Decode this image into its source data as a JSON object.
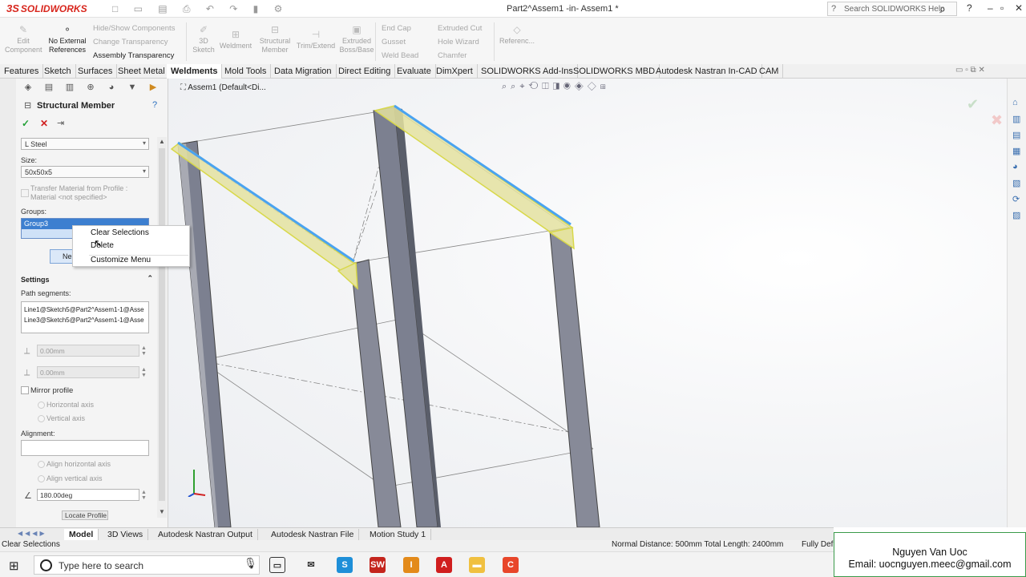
{
  "app": {
    "logo": "SOLIDWORKS",
    "logo_mark": "3S",
    "document_title": "Part2^Assem1 -in- Assem1 *",
    "search_placeholder": "Search SOLIDWORKS Help"
  },
  "command_manager": {
    "edit_component": "Edit Component",
    "no_external_references": "No External References",
    "hide_show": "Hide/Show Components",
    "change_transparency": "Change Transparency",
    "assembly_transparency": "Assembly Transparency",
    "sketch3d": "3D Sketch",
    "weldment": "Weldment",
    "structural_member": "Structural Member",
    "trim_extend": "Trim/Extend",
    "extruded_boss": "Extruded Boss/Base",
    "end_cap": "End Cap",
    "gusset": "Gusset",
    "weld_bead": "Weld Bead",
    "extruded_cut": "Extruded Cut",
    "hole_wizard": "Hole Wizard",
    "chamfer": "Chamfer",
    "reference": "Referenc..."
  },
  "tabs": [
    "Features",
    "Sketch",
    "Surfaces",
    "Sheet Metal",
    "Weldments",
    "Mold Tools",
    "Data Migration",
    "Direct Editing",
    "Evaluate",
    "DimXpert",
    "SOLIDWORKS Add-Ins",
    "SOLIDWORKS MBD",
    "Autodesk Nastran In-CAD",
    "CAM"
  ],
  "active_tab": "Weldments",
  "property_manager": {
    "title": "Structural Member",
    "profile_type": "L Steel",
    "size_label": "Size:",
    "size_value": "50x50x5",
    "transfer_material": "Transfer Material from Profile :",
    "material": "Material <not specified>",
    "groups_label": "Groups:",
    "group_selected": "Group3",
    "new_group": "Ne",
    "settings_label": "Settings",
    "path_segments_label": "Path segments:",
    "path_segments": [
      "Line1@Sketch5@Part2^Assem1-1@Asse",
      "Line3@Sketch5@Part2^Assem1-1@Asse"
    ],
    "offset1": "0.00mm",
    "offset2": "0.00mm",
    "mirror_profile": "Mirror profile",
    "horizontal_axis": "Horizontal axis",
    "vertical_axis": "Vertical axis",
    "alignment_label": "Alignment:",
    "align_horizontal": "Align horizontal axis",
    "align_vertical": "Align vertical axis",
    "rotation_angle": "180.00deg",
    "locate_profile": "Locate Profile"
  },
  "context_menu": {
    "items": [
      "Clear Selections",
      "Delete",
      "Customize Menu"
    ]
  },
  "viewport": {
    "tree_item": "Assem1  (Default<Di..."
  },
  "model_tabs": [
    "Model",
    "3D Views",
    "Autodesk Nastran Output",
    "Autodesk Nastran File",
    "Motion Study 1"
  ],
  "active_model_tab": "Model",
  "status": {
    "left": "Clear Selections",
    "measure": "Normal Distance: 500mm Total Length: 2400mm",
    "right": "Fully Def"
  },
  "watermark": {
    "name": "Nguyen Van Uoc",
    "email": "Email: uocnguyen.meec@gmail.com"
  },
  "taskbar": {
    "search_placeholder": "Type here to search"
  },
  "colors": {
    "selection_blue": "#4aa3f0",
    "selection_yellow": "#e8e84a",
    "member_gray": "#7c8090",
    "accent_red": "#d8261d"
  }
}
